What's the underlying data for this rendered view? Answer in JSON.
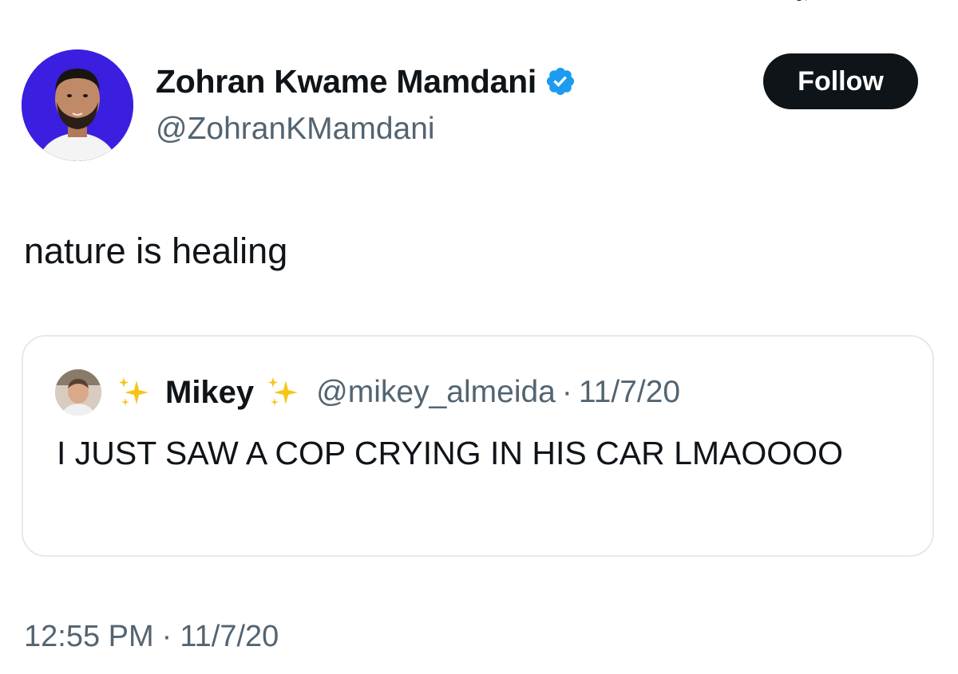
{
  "tweet": {
    "author": {
      "display_name": "Zohran Kwame Mamdani",
      "handle": "@ZohranKMamdani",
      "verified_icon": "verified-badge-icon",
      "avatar_bg": "#3a1fe0"
    },
    "follow_label": "Follow",
    "text": "nature is healing",
    "time": "12:55 PM",
    "separator": "·",
    "date": "11/7/20"
  },
  "quote": {
    "display_name": "Mikey",
    "handle": "@mikey_almeida",
    "separator": "·",
    "date": "11/7/20",
    "text": "I JUST SAW A COP CRYING IN HIS CAR LMAOOOO",
    "sparkle_icon": "sparkles-icon"
  },
  "colors": {
    "text_primary": "#0f1419",
    "text_secondary": "#536471",
    "verified_blue": "#1d9bf0",
    "follow_bg": "#0f1419",
    "card_border": "#e6e9ec",
    "sparkle_yellow": "#f5c518"
  }
}
